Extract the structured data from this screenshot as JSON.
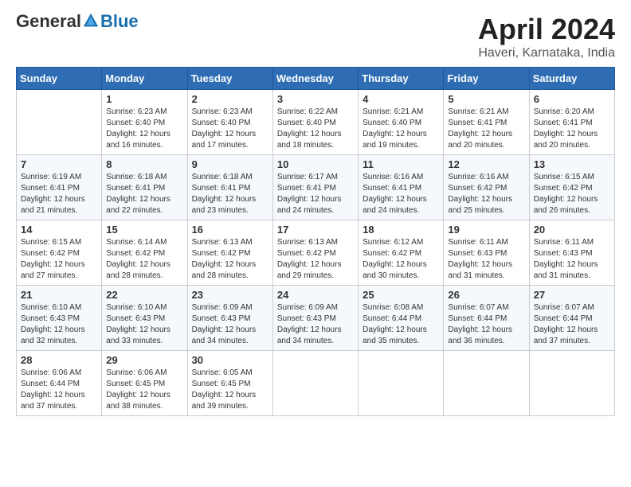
{
  "logo": {
    "general": "General",
    "blue": "Blue"
  },
  "title": "April 2024",
  "subtitle": "Haveri, Karnataka, India",
  "weekdays": [
    "Sunday",
    "Monday",
    "Tuesday",
    "Wednesday",
    "Thursday",
    "Friday",
    "Saturday"
  ],
  "weeks": [
    [
      {
        "day": "",
        "sunrise": "",
        "sunset": "",
        "daylight": ""
      },
      {
        "day": "1",
        "sunrise": "Sunrise: 6:23 AM",
        "sunset": "Sunset: 6:40 PM",
        "daylight": "Daylight: 12 hours and 16 minutes."
      },
      {
        "day": "2",
        "sunrise": "Sunrise: 6:23 AM",
        "sunset": "Sunset: 6:40 PM",
        "daylight": "Daylight: 12 hours and 17 minutes."
      },
      {
        "day": "3",
        "sunrise": "Sunrise: 6:22 AM",
        "sunset": "Sunset: 6:40 PM",
        "daylight": "Daylight: 12 hours and 18 minutes."
      },
      {
        "day": "4",
        "sunrise": "Sunrise: 6:21 AM",
        "sunset": "Sunset: 6:40 PM",
        "daylight": "Daylight: 12 hours and 19 minutes."
      },
      {
        "day": "5",
        "sunrise": "Sunrise: 6:21 AM",
        "sunset": "Sunset: 6:41 PM",
        "daylight": "Daylight: 12 hours and 20 minutes."
      },
      {
        "day": "6",
        "sunrise": "Sunrise: 6:20 AM",
        "sunset": "Sunset: 6:41 PM",
        "daylight": "Daylight: 12 hours and 20 minutes."
      }
    ],
    [
      {
        "day": "7",
        "sunrise": "Sunrise: 6:19 AM",
        "sunset": "Sunset: 6:41 PM",
        "daylight": "Daylight: 12 hours and 21 minutes."
      },
      {
        "day": "8",
        "sunrise": "Sunrise: 6:18 AM",
        "sunset": "Sunset: 6:41 PM",
        "daylight": "Daylight: 12 hours and 22 minutes."
      },
      {
        "day": "9",
        "sunrise": "Sunrise: 6:18 AM",
        "sunset": "Sunset: 6:41 PM",
        "daylight": "Daylight: 12 hours and 23 minutes."
      },
      {
        "day": "10",
        "sunrise": "Sunrise: 6:17 AM",
        "sunset": "Sunset: 6:41 PM",
        "daylight": "Daylight: 12 hours and 24 minutes."
      },
      {
        "day": "11",
        "sunrise": "Sunrise: 6:16 AM",
        "sunset": "Sunset: 6:41 PM",
        "daylight": "Daylight: 12 hours and 24 minutes."
      },
      {
        "day": "12",
        "sunrise": "Sunrise: 6:16 AM",
        "sunset": "Sunset: 6:42 PM",
        "daylight": "Daylight: 12 hours and 25 minutes."
      },
      {
        "day": "13",
        "sunrise": "Sunrise: 6:15 AM",
        "sunset": "Sunset: 6:42 PM",
        "daylight": "Daylight: 12 hours and 26 minutes."
      }
    ],
    [
      {
        "day": "14",
        "sunrise": "Sunrise: 6:15 AM",
        "sunset": "Sunset: 6:42 PM",
        "daylight": "Daylight: 12 hours and 27 minutes."
      },
      {
        "day": "15",
        "sunrise": "Sunrise: 6:14 AM",
        "sunset": "Sunset: 6:42 PM",
        "daylight": "Daylight: 12 hours and 28 minutes."
      },
      {
        "day": "16",
        "sunrise": "Sunrise: 6:13 AM",
        "sunset": "Sunset: 6:42 PM",
        "daylight": "Daylight: 12 hours and 28 minutes."
      },
      {
        "day": "17",
        "sunrise": "Sunrise: 6:13 AM",
        "sunset": "Sunset: 6:42 PM",
        "daylight": "Daylight: 12 hours and 29 minutes."
      },
      {
        "day": "18",
        "sunrise": "Sunrise: 6:12 AM",
        "sunset": "Sunset: 6:42 PM",
        "daylight": "Daylight: 12 hours and 30 minutes."
      },
      {
        "day": "19",
        "sunrise": "Sunrise: 6:11 AM",
        "sunset": "Sunset: 6:43 PM",
        "daylight": "Daylight: 12 hours and 31 minutes."
      },
      {
        "day": "20",
        "sunrise": "Sunrise: 6:11 AM",
        "sunset": "Sunset: 6:43 PM",
        "daylight": "Daylight: 12 hours and 31 minutes."
      }
    ],
    [
      {
        "day": "21",
        "sunrise": "Sunrise: 6:10 AM",
        "sunset": "Sunset: 6:43 PM",
        "daylight": "Daylight: 12 hours and 32 minutes."
      },
      {
        "day": "22",
        "sunrise": "Sunrise: 6:10 AM",
        "sunset": "Sunset: 6:43 PM",
        "daylight": "Daylight: 12 hours and 33 minutes."
      },
      {
        "day": "23",
        "sunrise": "Sunrise: 6:09 AM",
        "sunset": "Sunset: 6:43 PM",
        "daylight": "Daylight: 12 hours and 34 minutes."
      },
      {
        "day": "24",
        "sunrise": "Sunrise: 6:09 AM",
        "sunset": "Sunset: 6:43 PM",
        "daylight": "Daylight: 12 hours and 34 minutes."
      },
      {
        "day": "25",
        "sunrise": "Sunrise: 6:08 AM",
        "sunset": "Sunset: 6:44 PM",
        "daylight": "Daylight: 12 hours and 35 minutes."
      },
      {
        "day": "26",
        "sunrise": "Sunrise: 6:07 AM",
        "sunset": "Sunset: 6:44 PM",
        "daylight": "Daylight: 12 hours and 36 minutes."
      },
      {
        "day": "27",
        "sunrise": "Sunrise: 6:07 AM",
        "sunset": "Sunset: 6:44 PM",
        "daylight": "Daylight: 12 hours and 37 minutes."
      }
    ],
    [
      {
        "day": "28",
        "sunrise": "Sunrise: 6:06 AM",
        "sunset": "Sunset: 6:44 PM",
        "daylight": "Daylight: 12 hours and 37 minutes."
      },
      {
        "day": "29",
        "sunrise": "Sunrise: 6:06 AM",
        "sunset": "Sunset: 6:45 PM",
        "daylight": "Daylight: 12 hours and 38 minutes."
      },
      {
        "day": "30",
        "sunrise": "Sunrise: 6:05 AM",
        "sunset": "Sunset: 6:45 PM",
        "daylight": "Daylight: 12 hours and 39 minutes."
      },
      {
        "day": "",
        "sunrise": "",
        "sunset": "",
        "daylight": ""
      },
      {
        "day": "",
        "sunrise": "",
        "sunset": "",
        "daylight": ""
      },
      {
        "day": "",
        "sunrise": "",
        "sunset": "",
        "daylight": ""
      },
      {
        "day": "",
        "sunrise": "",
        "sunset": "",
        "daylight": ""
      }
    ]
  ]
}
